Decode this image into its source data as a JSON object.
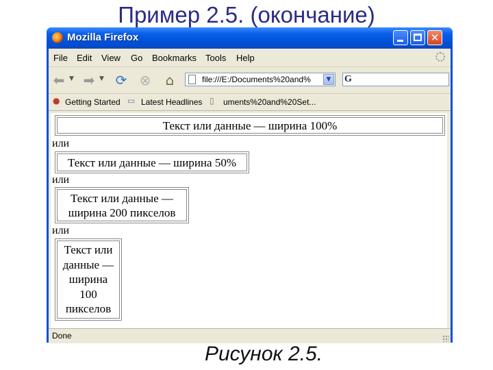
{
  "slide": {
    "title": "Пример 2.5. (окончание)",
    "caption": "Рисунок 2.5."
  },
  "window": {
    "title": "Mozilla Firefox",
    "buttons": {
      "minimize": "minimize",
      "maximize": "maximize",
      "close": "✕"
    }
  },
  "menubar": {
    "items": [
      "File",
      "Edit",
      "View",
      "Go",
      "Bookmarks",
      "Tools",
      "Help"
    ]
  },
  "navbar": {
    "url": "file:///E:/Documents%20and%",
    "search_engine": "G",
    "icons": [
      "back-arrow-icon",
      "forward-arrow-icon",
      "reload-icon",
      "stop-icon",
      "home-icon"
    ]
  },
  "bookmarks": {
    "items": [
      "Getting Started",
      "Latest Headlines",
      "uments%20and%20Set..."
    ]
  },
  "content": {
    "table1": "Текст или данные — ширина 100%",
    "or1": "или",
    "table2": "Текст или данные — ширина 50%",
    "or2": "или",
    "table3_line1": "Текст или данные —",
    "table3_line2": "ширина 200 пикселов",
    "or3": "или",
    "table4_lines": [
      "Текст или",
      "данные —",
      "ширина",
      "100",
      "пикселов"
    ]
  },
  "status": {
    "text": "Done"
  },
  "colors": {
    "title": "#2b2b86",
    "titlebar": "#0250d8",
    "chrome": "#ece9d8"
  }
}
